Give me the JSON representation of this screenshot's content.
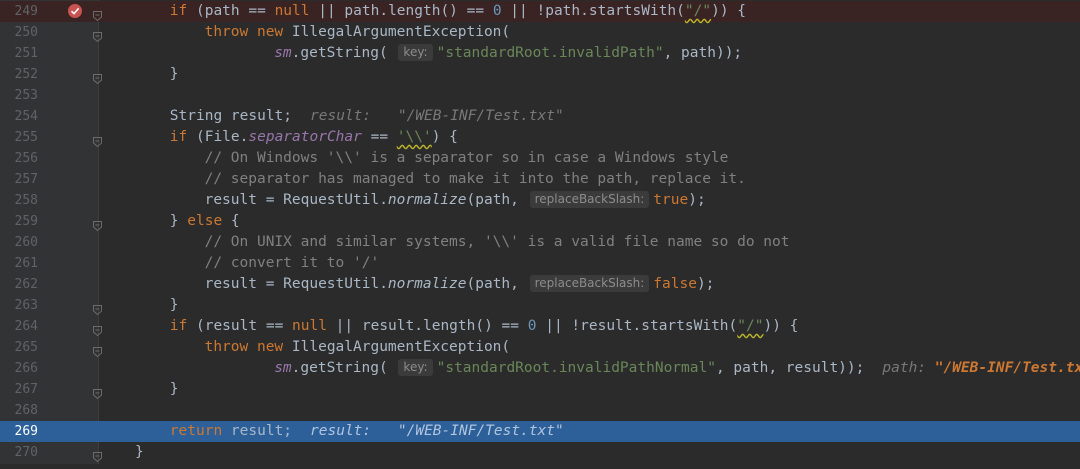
{
  "editor": {
    "lines": [
      {
        "n": "249",
        "segs": [
          [
            "if",
            "kw"
          ],
          " (path == ",
          [
            "null",
            "kw"
          ],
          " || path.length() == ",
          [
            "0",
            "num"
          ],
          " || !path.startsWith(",
          [
            "\"/\"",
            "str wavy"
          ],
          ")) {"
        ]
      },
      {
        "n": "250",
        "segs": [
          [
            "throw new",
            "kw"
          ],
          " IllegalArgumentException("
        ]
      },
      {
        "n": "251",
        "segs": [
          [
            "sm",
            "sm"
          ],
          ".getString( ",
          [
            "key:",
            "hint"
          ],
          [
            "\"standardRoot.invalidPath\"",
            "str"
          ],
          ", path));"
        ]
      },
      {
        "n": "252",
        "segs": [
          "}"
        ]
      },
      {
        "n": "253",
        "segs": []
      },
      {
        "n": "254",
        "segs": [
          "String result;",
          [
            "result: ",
            "inl"
          ],
          [
            "\"/WEB-INF/Test.txt\"",
            "inl"
          ]
        ]
      },
      {
        "n": "255",
        "segs": [
          [
            "if",
            "kw"
          ],
          " (File.",
          [
            "separatorChar",
            "fld"
          ],
          " == ",
          [
            "'\\\\'",
            "str wavy"
          ],
          ") {"
        ]
      },
      {
        "n": "256",
        "segs": [
          [
            "// On Windows '\\\\' is a separator so in case a Windows style",
            "cm"
          ]
        ]
      },
      {
        "n": "257",
        "segs": [
          [
            "// separator has managed to make it into the path, replace it.",
            "cm"
          ]
        ]
      },
      {
        "n": "258",
        "segs": [
          "result = RequestUtil.",
          [
            "normalize",
            "it"
          ],
          "(path, ",
          [
            "replaceBackSlash:",
            "hint"
          ],
          [
            "true",
            "kw"
          ],
          ");"
        ]
      },
      {
        "n": "259",
        "segs": [
          "} ",
          [
            "else",
            "kw"
          ],
          " {"
        ]
      },
      {
        "n": "260",
        "segs": [
          [
            "// On UNIX and similar systems, '\\\\' is a valid file name so do not",
            "cm"
          ]
        ]
      },
      {
        "n": "261",
        "segs": [
          [
            "// convert it to '/'",
            "cm"
          ]
        ]
      },
      {
        "n": "262",
        "segs": [
          "result = RequestUtil.",
          [
            "normalize",
            "it"
          ],
          "(path, ",
          [
            "replaceBackSlash:",
            "hint"
          ],
          [
            "false",
            "kw"
          ],
          ");"
        ]
      },
      {
        "n": "263",
        "segs": [
          "}"
        ]
      },
      {
        "n": "264",
        "segs": [
          [
            "if",
            "kw"
          ],
          " (result == ",
          [
            "null",
            "kw"
          ],
          " || result.length() == ",
          [
            "0",
            "num"
          ],
          " || !result.startsWith(",
          [
            "\"/\"",
            "str wavy"
          ],
          ")) {"
        ]
      },
      {
        "n": "265",
        "segs": [
          [
            "throw new",
            "kw"
          ],
          " IllegalArgumentException("
        ]
      },
      {
        "n": "266",
        "segs": [
          [
            "sm",
            "sm"
          ],
          ".getString( ",
          [
            "key:",
            "hint"
          ],
          [
            "\"standardRoot.invalidPathNormal\"",
            "str"
          ],
          ", path, result));",
          [
            "path: ",
            "inl"
          ],
          [
            "\"/WEB-INF/Test.txt\"",
            "inl-v"
          ]
        ]
      },
      {
        "n": "267",
        "segs": [
          "}"
        ]
      },
      {
        "n": "268",
        "segs": []
      },
      {
        "n": "269",
        "segs": [
          [
            "return",
            "kw"
          ],
          " result;",
          [
            "result: ",
            "inl"
          ],
          [
            "\"/WEB-INF/Test.txt\"",
            "inl"
          ]
        ]
      },
      {
        "n": "270",
        "segs": [
          "}"
        ]
      }
    ]
  },
  "markers": {
    "breakpoint_line": "249",
    "execution_line": "269"
  },
  "colors": {
    "background": "#2b2b2b",
    "gutter": "#313335",
    "keyword": "#cc7832",
    "string": "#6a8759",
    "number": "#6897bb",
    "comment": "#808080",
    "execution_highlight": "#2d6099",
    "breakpoint": "#c75450"
  },
  "icons": [
    "breakpoint-icon",
    "fold-icon"
  ]
}
